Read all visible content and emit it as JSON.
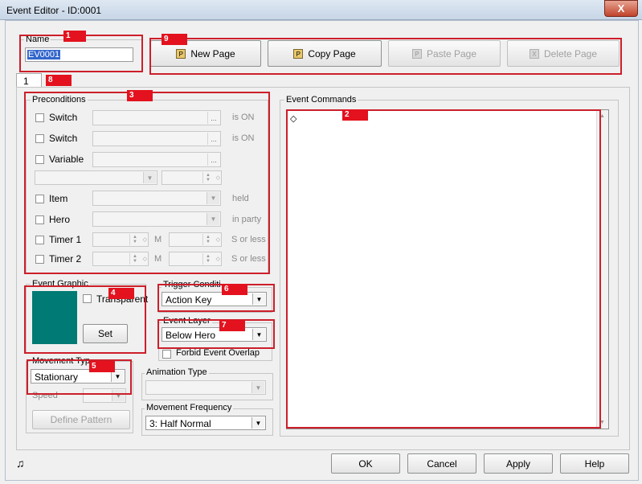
{
  "window": {
    "title": "Event Editor - ID:0001",
    "close_label": "X"
  },
  "name_group": {
    "label": "Name",
    "value": "EV0001"
  },
  "page_tab": {
    "label": "1"
  },
  "page_buttons": [
    {
      "label": "New Page",
      "icon": "page-icon"
    },
    {
      "label": "Copy Page",
      "icon": "copy-page-icon"
    },
    {
      "label": "Paste Page",
      "icon": "paste-page-icon"
    },
    {
      "label": "Delete Page",
      "icon": "delete-page-icon"
    }
  ],
  "preconditions": {
    "label": "Preconditions",
    "switch1": {
      "label": "Switch",
      "suffix": "is ON"
    },
    "switch2": {
      "label": "Switch",
      "suffix": "is ON"
    },
    "variable": {
      "label": "Variable"
    },
    "item": {
      "label": "Item",
      "suffix": "held"
    },
    "hero": {
      "label": "Hero",
      "suffix": "in party"
    },
    "timer1": {
      "label": "Timer 1",
      "m": "M",
      "s": "S or less"
    },
    "timer2": {
      "label": "Timer 2",
      "m": "M",
      "s": "S or less"
    },
    "dots": "...",
    "spin_check": "◇"
  },
  "event_graphic": {
    "label": "Event Graphic",
    "transparent_label": "Transparent",
    "set_label": "Set",
    "color": "#007a74"
  },
  "trigger": {
    "label": "Trigger Conditi",
    "value": "Action Key"
  },
  "layer": {
    "label": "Event Layer",
    "value": "Below Hero",
    "forbid_label": "Forbid Event Overlap"
  },
  "movement_type": {
    "label": "Movement Typ",
    "value": "Stationary",
    "speed_label": "Speed",
    "define_label": "Define Pattern"
  },
  "animation": {
    "label": "Animation Type"
  },
  "frequency": {
    "label": "Movement Frequency",
    "value": "3: Half Normal"
  },
  "commands": {
    "label": "Event Commands",
    "first_line": "◇",
    "scroll_up": "▲",
    "scroll_down": "▼"
  },
  "footer": {
    "ok": "OK",
    "cancel": "Cancel",
    "apply": "Apply",
    "help": "Help",
    "music_icon": "♫"
  },
  "annotations": [
    "1",
    "2",
    "3",
    "4",
    "5",
    "6",
    "7",
    "8",
    "9"
  ],
  "colors": {
    "highlight_red": "#cc1f2a",
    "tag_red": "#e3121e",
    "graphic": "#007a74"
  }
}
